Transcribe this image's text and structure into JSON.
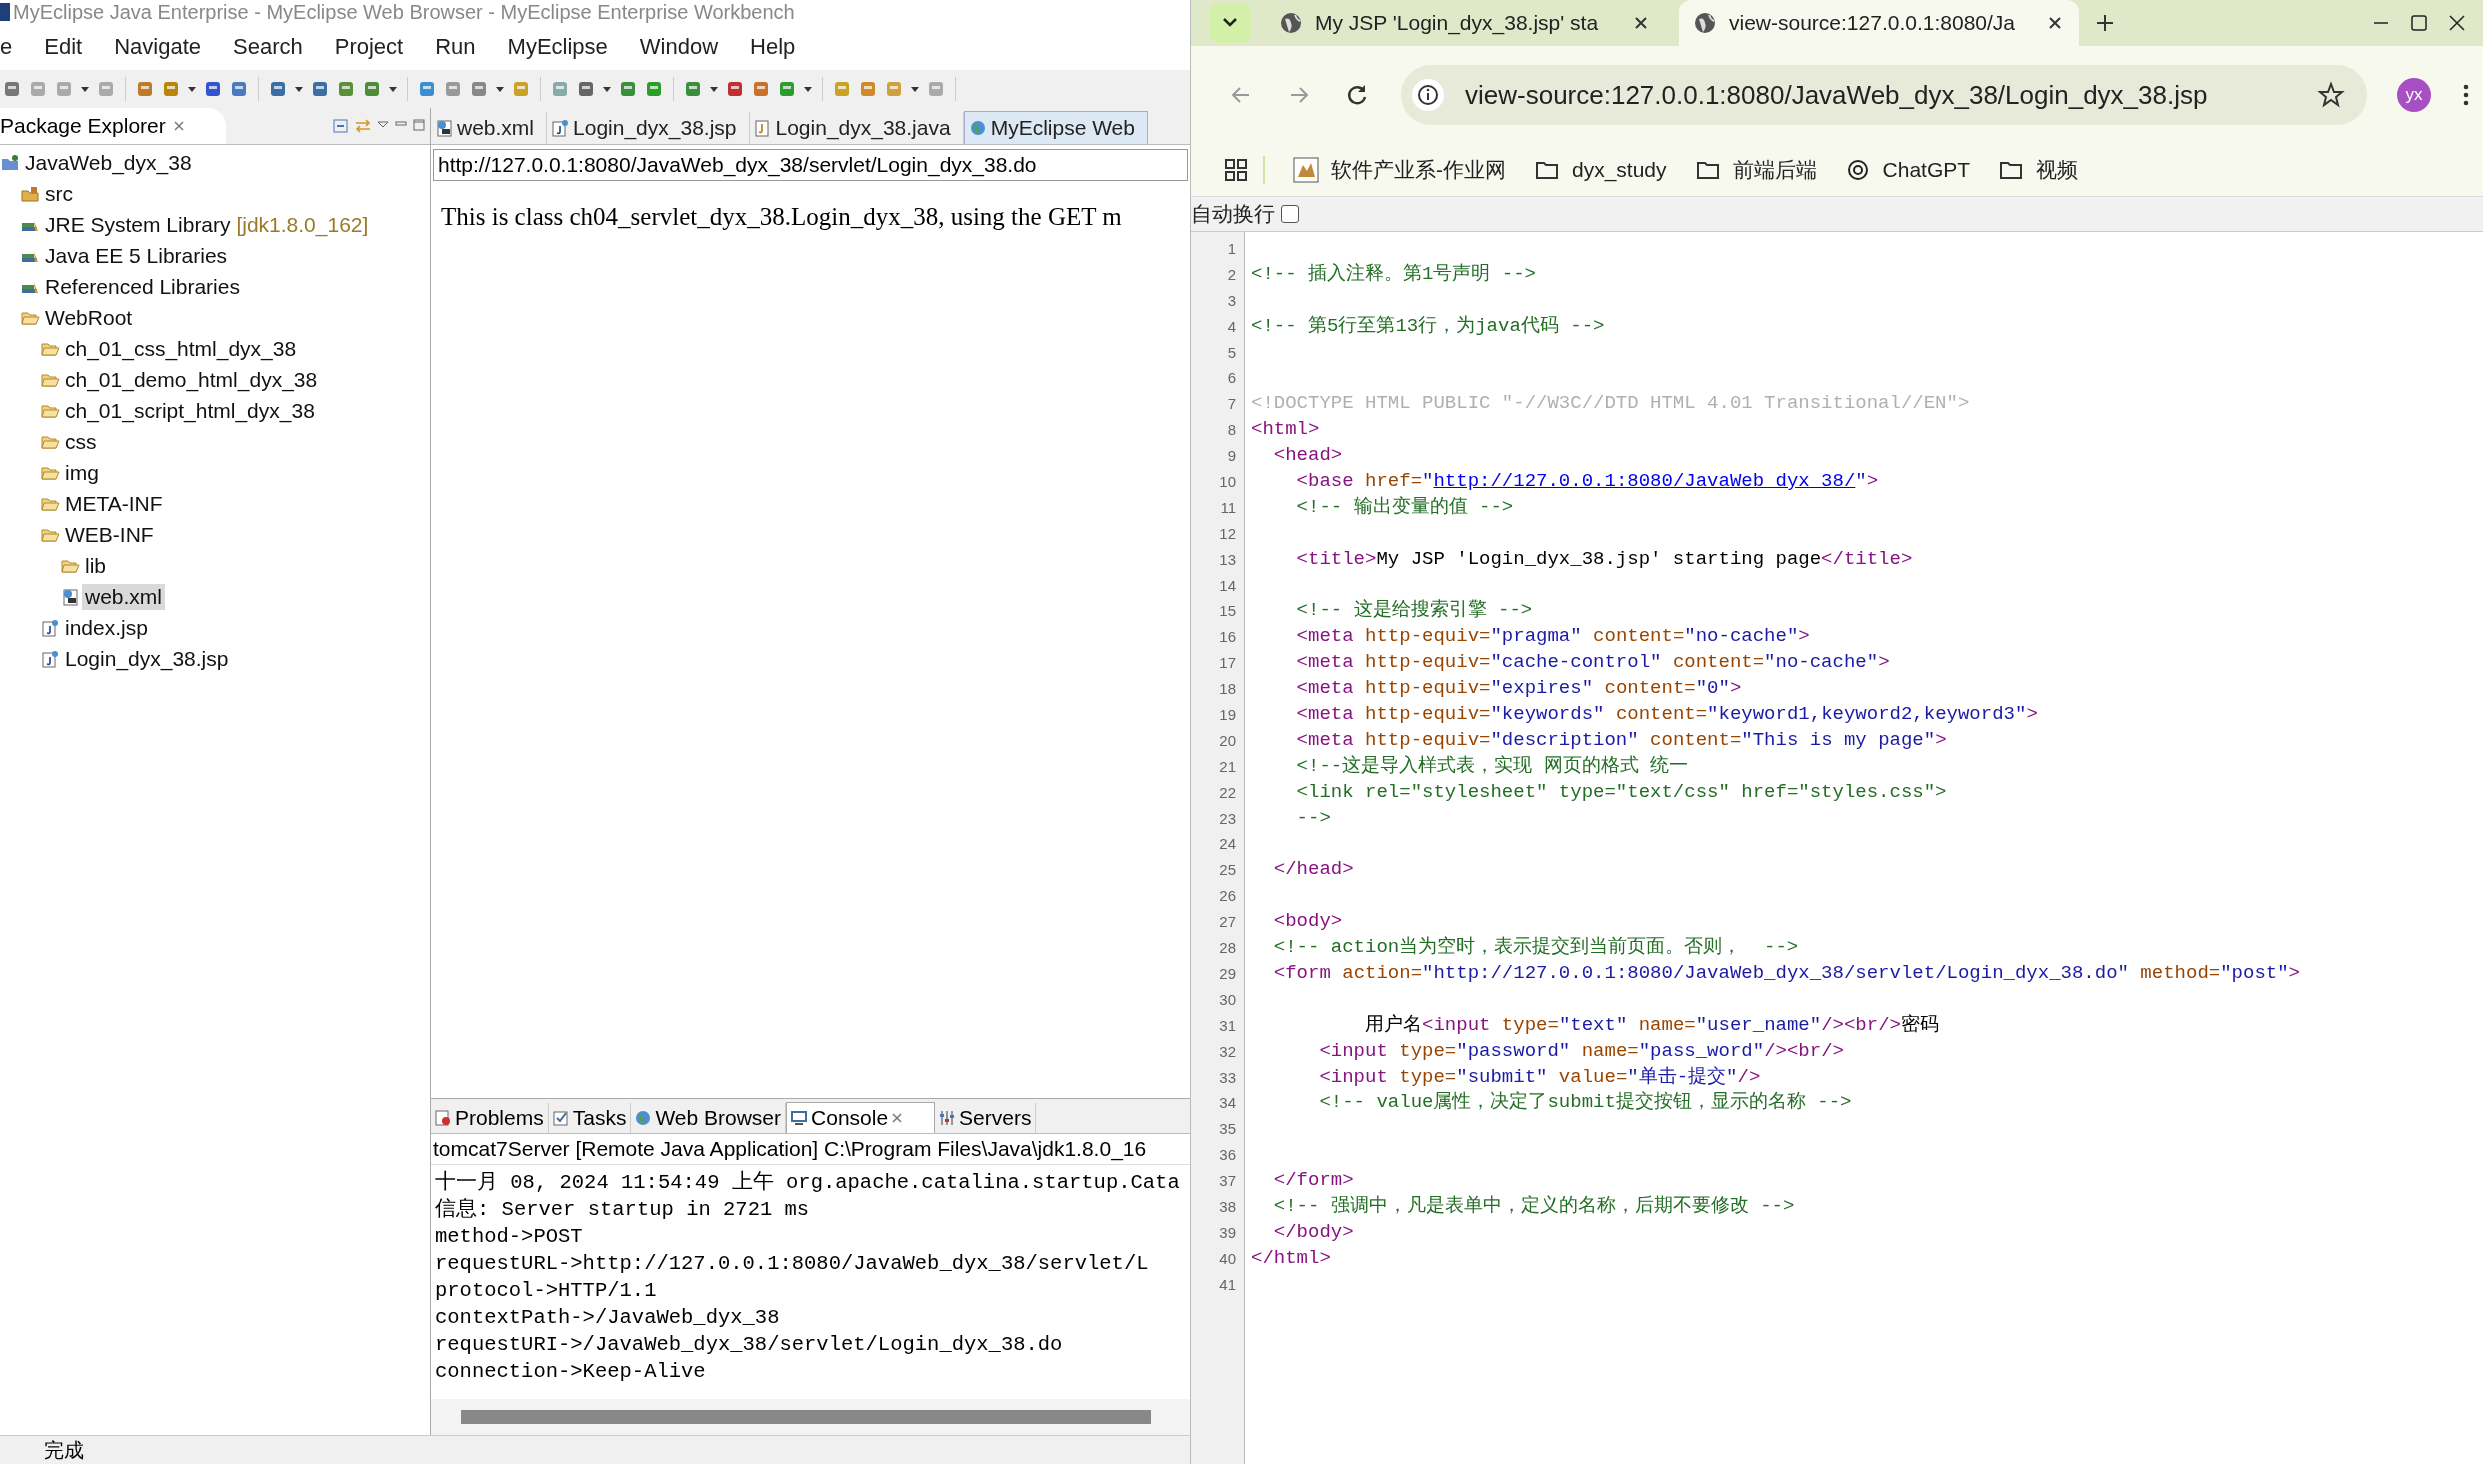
{
  "eclipse": {
    "window_title": "MyEclipse Java Enterprise - MyEclipse Web Browser - MyEclipse Enterprise Workbench",
    "menu": [
      "e",
      "Edit",
      "Navigate",
      "Search",
      "Project",
      "Run",
      "MyEclipse",
      "Window",
      "Help"
    ],
    "package_explorer": {
      "title": "Package Explorer",
      "tree": [
        {
          "label": "JavaWeb_dyx_38",
          "kind": "project",
          "selected": false,
          "children": [
            {
              "label": "src",
              "kind": "package",
              "selected": false
            },
            {
              "label": "JRE System Library",
              "decoration": "[jdk1.8.0_162]",
              "kind": "library",
              "selected": false
            },
            {
              "label": "Java EE 5 Libraries",
              "kind": "library",
              "selected": false
            },
            {
              "label": "Referenced Libraries",
              "kind": "library",
              "selected": false
            },
            {
              "label": "WebRoot",
              "kind": "folder",
              "selected": false,
              "children": [
                {
                  "label": "ch_01_css_html_dyx_38",
                  "kind": "folder",
                  "selected": false
                },
                {
                  "label": "ch_01_demo_html_dyx_38",
                  "kind": "folder",
                  "selected": false
                },
                {
                  "label": "ch_01_script_html_dyx_38",
                  "kind": "folder",
                  "selected": false
                },
                {
                  "label": "css",
                  "kind": "folder",
                  "selected": false
                },
                {
                  "label": "img",
                  "kind": "folder",
                  "selected": false
                },
                {
                  "label": "META-INF",
                  "kind": "folder",
                  "selected": false
                },
                {
                  "label": "WEB-INF",
                  "kind": "folder",
                  "selected": false,
                  "children": [
                    {
                      "label": "lib",
                      "kind": "folder",
                      "selected": false
                    },
                    {
                      "label": "web.xml",
                      "kind": "xml",
                      "selected": true
                    }
                  ]
                },
                {
                  "label": "index.jsp",
                  "kind": "jsp",
                  "selected": false
                },
                {
                  "label": "Login_dyx_38.jsp",
                  "kind": "jsp",
                  "selected": false
                }
              ]
            }
          ]
        }
      ]
    },
    "editor_tabs": [
      {
        "label": "web.xml",
        "kind": "xml",
        "selected": false
      },
      {
        "label": "Login_dyx_38.jsp",
        "kind": "jsp",
        "selected": false
      },
      {
        "label": "Login_dyx_38.java",
        "kind": "java",
        "selected": false
      },
      {
        "label": "MyEclipse Web",
        "kind": "browser",
        "selected": true
      }
    ],
    "browser_url": "http://127.0.0.1:8080/JavaWeb_dyx_38/servlet/Login_dyx_38.do",
    "page_text": "This is class ch04_servlet_dyx_38.Login_dyx_38, using the GET m",
    "bottom_tabs": [
      {
        "label": "Problems",
        "kind": "problems",
        "selected": false
      },
      {
        "label": "Tasks",
        "kind": "tasks",
        "selected": false
      },
      {
        "label": "Web Browser",
        "kind": "browser",
        "selected": false
      },
      {
        "label": "Console",
        "kind": "console",
        "selected": true
      },
      {
        "label": "Servers",
        "kind": "servers",
        "selected": false
      }
    ],
    "console_title": "tomcat7Server [Remote Java Application] C:\\Program Files\\Java\\jdk1.8.0_16",
    "console_lines": [
      "十一月 08, 2024 11:54:49 上午 org.apache.catalina.startup.Cata",
      "信息: Server startup in 2721 ms",
      "method->POST",
      "requestURL->http://127.0.0.1:8080/JavaWeb_dyx_38/servlet/L",
      "protocol->HTTP/1.1",
      "contextPath->/JavaWeb_dyx_38",
      "requestURI->/JavaWeb_dyx_38/servlet/Login_dyx_38.do",
      "connection->Keep-Alive"
    ],
    "status": "完成"
  },
  "chrome": {
    "tabs": [
      {
        "title": "My JSP 'Login_dyx_38.jsp' sta",
        "selected": false
      },
      {
        "title": "view-source:127.0.0.1:8080/Ja",
        "selected": true
      }
    ],
    "address": "view-source:127.0.0.1:8080/JavaWeb_dyx_38/Login_dyx_38.jsp",
    "avatar": "yx",
    "bookmarks": [
      {
        "label": "软件产业系-作业网",
        "kind": "site"
      },
      {
        "label": "dyx_study",
        "kind": "folder"
      },
      {
        "label": "前端后端",
        "kind": "folder"
      },
      {
        "label": "ChatGPT",
        "kind": "chatgpt"
      },
      {
        "label": "视频",
        "kind": "folder"
      }
    ],
    "wrap_option": {
      "label": "自动换行",
      "checked": false
    },
    "source_lines": [
      {
        "number": "1"
      },
      {
        "number": "2",
        "tokens": [
          {
            "kind": "comment",
            "text": "<!-- 插入注释。第1号声明 -->"
          }
        ]
      },
      {
        "number": "3"
      },
      {
        "number": "4",
        "tokens": [
          {
            "kind": "comment",
            "text": "<!-- 第5行至第13行，为java代码 -->"
          }
        ]
      },
      {
        "number": "5"
      },
      {
        "number": "6"
      },
      {
        "number": "7",
        "tokens": [
          {
            "kind": "doctype",
            "text": "<!DOCTYPE HTML PUBLIC \"-//W3C//DTD HTML 4.01 Transitional//EN\">"
          }
        ]
      },
      {
        "number": "8",
        "tokens": [
          {
            "kind": "tag",
            "text": "<html>"
          }
        ]
      },
      {
        "number": "9",
        "tokens": [
          {
            "kind": "tag",
            "text": "  <head>"
          }
        ]
      },
      {
        "number": "10",
        "tokens": [
          {
            "kind": "tag",
            "text": "    <base"
          },
          {
            "kind": "attr",
            "text": " href="
          },
          {
            "kind": "value",
            "text": "\""
          },
          {
            "kind": "link",
            "text": "http://127.0.0.1:8080/JavaWeb_dyx_38/"
          },
          {
            "kind": "value",
            "text": "\""
          },
          {
            "kind": "tag",
            "text": ">"
          }
        ]
      },
      {
        "number": "11",
        "tokens": [
          {
            "kind": "comment",
            "text": "    <!-- 输出变量的值 -->"
          }
        ]
      },
      {
        "number": "12"
      },
      {
        "number": "13",
        "tokens": [
          {
            "kind": "tag",
            "text": "    <title>"
          },
          {
            "kind": "text",
            "text": "My JSP 'Login_dyx_38.jsp' starting page"
          },
          {
            "kind": "tag",
            "text": "</title>"
          }
        ]
      },
      {
        "number": "14"
      },
      {
        "number": "15",
        "tokens": [
          {
            "kind": "comment",
            "text": "    <!-- 这是给搜索引擎 -->"
          }
        ]
      },
      {
        "number": "16",
        "tokens": [
          {
            "kind": "tag",
            "text": "    <meta"
          },
          {
            "kind": "attr",
            "text": " http-equiv="
          },
          {
            "kind": "value",
            "text": "\"pragma\""
          },
          {
            "kind": "attr",
            "text": " content="
          },
          {
            "kind": "value",
            "text": "\"no-cache\""
          },
          {
            "kind": "tag",
            "text": ">"
          }
        ]
      },
      {
        "number": "17",
        "tokens": [
          {
            "kind": "tag",
            "text": "    <meta"
          },
          {
            "kind": "attr",
            "text": " http-equiv="
          },
          {
            "kind": "value",
            "text": "\"cache-control\""
          },
          {
            "kind": "attr",
            "text": " content="
          },
          {
            "kind": "value",
            "text": "\"no-cache\""
          },
          {
            "kind": "tag",
            "text": ">"
          }
        ]
      },
      {
        "number": "18",
        "tokens": [
          {
            "kind": "tag",
            "text": "    <meta"
          },
          {
            "kind": "attr",
            "text": " http-equiv="
          },
          {
            "kind": "value",
            "text": "\"expires\""
          },
          {
            "kind": "attr",
            "text": " content="
          },
          {
            "kind": "value",
            "text": "\"0\""
          },
          {
            "kind": "tag",
            "text": ">"
          }
        ]
      },
      {
        "number": "19",
        "tokens": [
          {
            "kind": "tag",
            "text": "    <meta"
          },
          {
            "kind": "attr",
            "text": " http-equiv="
          },
          {
            "kind": "value",
            "text": "\"keywords\""
          },
          {
            "kind": "attr",
            "text": " content="
          },
          {
            "kind": "value",
            "text": "\"keyword1,keyword2,keyword3\""
          },
          {
            "kind": "tag",
            "text": ">"
          }
        ]
      },
      {
        "number": "20",
        "tokens": [
          {
            "kind": "tag",
            "text": "    <meta"
          },
          {
            "kind": "attr",
            "text": " http-equiv="
          },
          {
            "kind": "value",
            "text": "\"description\""
          },
          {
            "kind": "attr",
            "text": " content="
          },
          {
            "kind": "value",
            "text": "\"This is my page\""
          },
          {
            "kind": "tag",
            "text": ">"
          }
        ]
      },
      {
        "number": "21",
        "tokens": [
          {
            "kind": "comment",
            "text": "    <!--这是导入样式表，实现 网页的格式 统一"
          }
        ]
      },
      {
        "number": "22",
        "tokens": [
          {
            "kind": "comment",
            "text": "    <link rel=\"stylesheet\" type=\"text/css\" href=\"styles.css\">"
          }
        ]
      },
      {
        "number": "23",
        "tokens": [
          {
            "kind": "comment",
            "text": "    -->"
          }
        ]
      },
      {
        "number": "24"
      },
      {
        "number": "25",
        "tokens": [
          {
            "kind": "tag",
            "text": "  </head>"
          }
        ]
      },
      {
        "number": "26"
      },
      {
        "number": "27",
        "tokens": [
          {
            "kind": "tag",
            "text": "  <body>"
          }
        ]
      },
      {
        "number": "28",
        "tokens": [
          {
            "kind": "comment",
            "text": "  <!-- action当为空时，表示提交到当前页面。否则，  -->"
          }
        ]
      },
      {
        "number": "29",
        "tokens": [
          {
            "kind": "tag",
            "text": "  <form"
          },
          {
            "kind": "attr",
            "text": " action="
          },
          {
            "kind": "value",
            "text": "\"http://127.0.0.1:8080/JavaWeb_dyx_38/servlet/Login_dyx_38.do\""
          },
          {
            "kind": "attr",
            "text": " method="
          },
          {
            "kind": "value",
            "text": "\"post\""
          },
          {
            "kind": "tag",
            "text": ">"
          }
        ]
      },
      {
        "number": "30"
      },
      {
        "number": "31",
        "tokens": [
          {
            "kind": "text",
            "text": "          用户名"
          },
          {
            "kind": "tag",
            "text": "<input"
          },
          {
            "kind": "attr",
            "text": " type="
          },
          {
            "kind": "value",
            "text": "\"text\""
          },
          {
            "kind": "attr",
            "text": " name="
          },
          {
            "kind": "value",
            "text": "\"user_name\""
          },
          {
            "kind": "tag",
            "text": "/><br/>"
          },
          {
            "kind": "text",
            "text": "密码"
          }
        ]
      },
      {
        "number": "32",
        "tokens": [
          {
            "kind": "tag",
            "text": "      <input"
          },
          {
            "kind": "attr",
            "text": " type="
          },
          {
            "kind": "value",
            "text": "\"password\""
          },
          {
            "kind": "attr",
            "text": " name="
          },
          {
            "kind": "value",
            "text": "\"pass_word\""
          },
          {
            "kind": "tag",
            "text": "/><br/>"
          }
        ]
      },
      {
        "number": "33",
        "tokens": [
          {
            "kind": "tag",
            "text": "      <input"
          },
          {
            "kind": "attr",
            "text": " type="
          },
          {
            "kind": "value",
            "text": "\"submit\""
          },
          {
            "kind": "attr",
            "text": " value="
          },
          {
            "kind": "value",
            "text": "\"单击-提交\""
          },
          {
            "kind": "tag",
            "text": "/>"
          }
        ]
      },
      {
        "number": "34",
        "tokens": [
          {
            "kind": "comment",
            "text": "      <!-- value属性，决定了submit提交按钮，显示的名称 -->"
          }
        ]
      },
      {
        "number": "35"
      },
      {
        "number": "36"
      },
      {
        "number": "37",
        "tokens": [
          {
            "kind": "tag",
            "text": "  </form>"
          }
        ]
      },
      {
        "number": "38",
        "tokens": [
          {
            "kind": "comment",
            "text": "  <!-- 强调中，凡是表单中，定义的名称，后期不要修改 -->"
          }
        ]
      },
      {
        "number": "39",
        "tokens": [
          {
            "kind": "tag",
            "text": "  </body>"
          }
        ]
      },
      {
        "number": "40",
        "tokens": [
          {
            "kind": "tag",
            "text": "</html>"
          }
        ]
      },
      {
        "number": "41"
      }
    ]
  }
}
